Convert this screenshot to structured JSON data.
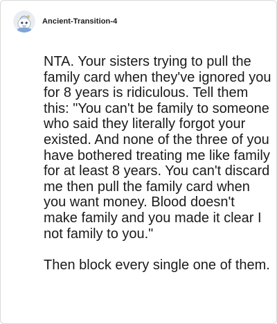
{
  "comment": {
    "author": "Ancient-Transition-4",
    "avatar": "snoo-avatar-icon",
    "paragraphs": [
      "NTA. Your sisters trying to pull the family card when they've ignored you for 8 years is ridiculous. Tell them this: \"You can't be family to someone who said they literally forgot your existed. And none of the three of you have bothered treating me like family for at least 8 years. You can't discard me then pull the family card when you want money. Blood doesn't make family and you made it clear I not family to you.\"",
      "Then block every single one of them."
    ]
  },
  "colors": {
    "text": "#1a1a1b",
    "border": "#d9d9d9",
    "background": "#ffffff"
  }
}
